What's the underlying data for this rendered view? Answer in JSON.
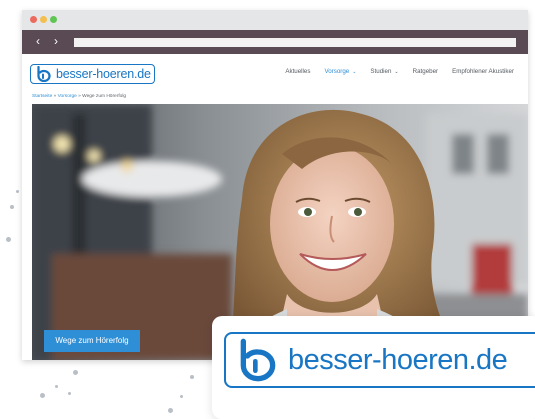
{
  "site": {
    "logo_text": "besser-hoeren.de",
    "logo_mark": "bh-logo-icon"
  },
  "browser": {
    "back_icon": "chevron-left-icon",
    "forward_icon": "chevron-right-icon",
    "back_glyph": "‹",
    "forward_glyph": "›"
  },
  "nav": {
    "items": [
      {
        "label": "Aktuelles"
      },
      {
        "label": "Vorsorge",
        "chevron": "⌄"
      },
      {
        "label": "Studien",
        "chevron": "⌄"
      },
      {
        "label": "Ratgeber"
      },
      {
        "label": "Empfohlener Akustiker"
      }
    ]
  },
  "breadcrumb": {
    "home": "Startseite",
    "sep1": " » ",
    "section": "Vorsorge",
    "sep2": " » ",
    "current": "Wege zum Hörerfolg"
  },
  "hero": {
    "button_label": "Wege zum Hörerfolg",
    "image": "smiling-woman-photo"
  },
  "overlay_card": {
    "logo_text": "besser-hoeren.de"
  },
  "colors": {
    "brand_blue": "#1976c4",
    "accent_blue": "#2f8fd6",
    "titlebar": "#e4e6e8",
    "navbar": "#5a4a54"
  }
}
